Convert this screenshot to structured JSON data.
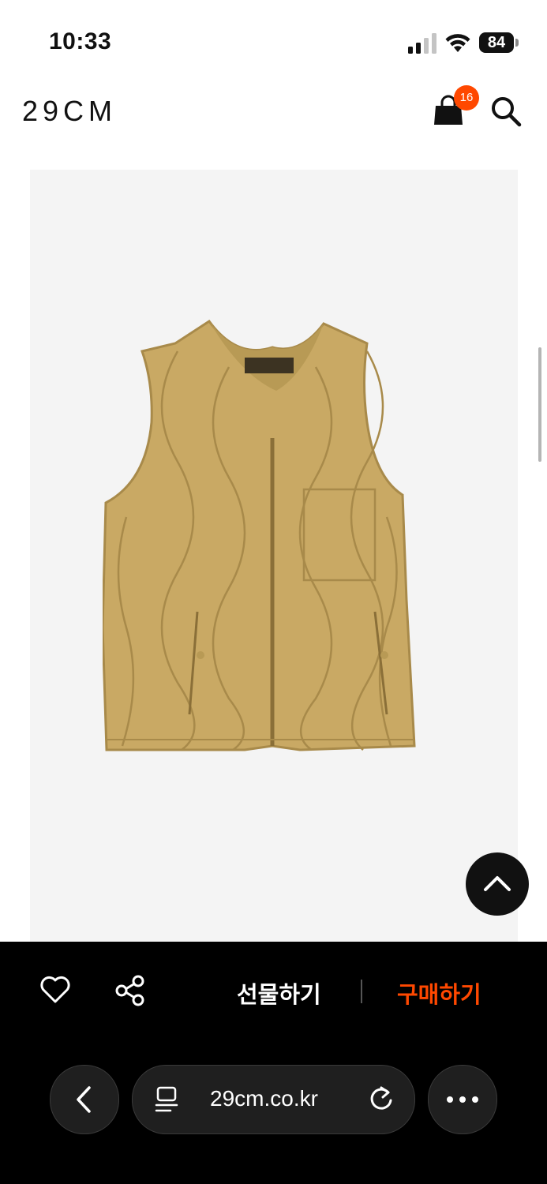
{
  "status_bar": {
    "time": "10:33",
    "battery": "84",
    "icons": [
      "signal-icon",
      "wifi-icon",
      "battery-icon"
    ]
  },
  "header": {
    "logo": "29CM",
    "cart_count": "16",
    "icons": [
      "shopping-bag-icon",
      "search-icon"
    ]
  },
  "product": {
    "image": "quilted-vest-image",
    "background_color": "#f4f4f4",
    "vest_color": "#c9a964"
  },
  "actions": {
    "gift_label": "선물하기",
    "buy_label": "구매하기",
    "accent_color": "#ff4800",
    "icons": [
      "heart-icon",
      "share-icon"
    ]
  },
  "browser": {
    "url": "29cm.co.kr",
    "icons": [
      "back-icon",
      "reader-icon",
      "reload-icon",
      "more-icon",
      "scroll-to-top-icon"
    ]
  }
}
